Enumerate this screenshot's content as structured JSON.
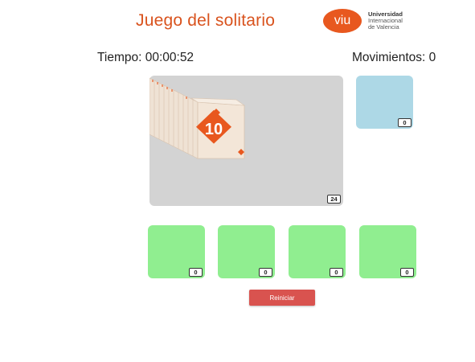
{
  "header": {
    "title": "Juego del solitario",
    "logo": {
      "mark": "viu",
      "lines": [
        "Universidad",
        "Internacional",
        "de Valencia"
      ]
    }
  },
  "status": {
    "time": "Tiempo: 00:00:52",
    "moves": "Movimientos: 0"
  },
  "deck": {
    "count": "24",
    "top_card": {
      "value": "10",
      "suit_icon": "diamond-icon"
    }
  },
  "waste": {
    "count": "0"
  },
  "foundations": [
    {
      "count": "0"
    },
    {
      "count": "0"
    },
    {
      "count": "0"
    },
    {
      "count": "0"
    }
  ],
  "actions": {
    "reset_label": "Reiniciar"
  },
  "colors": {
    "accent": "#d9531e",
    "card_face": "#f3e6d8",
    "card_diamond": "#e8581f",
    "deck_bg": "#d3d3d3",
    "waste_bg": "#add8e6",
    "foundation_bg": "#90ee90",
    "reset_bg": "#d9534f"
  }
}
